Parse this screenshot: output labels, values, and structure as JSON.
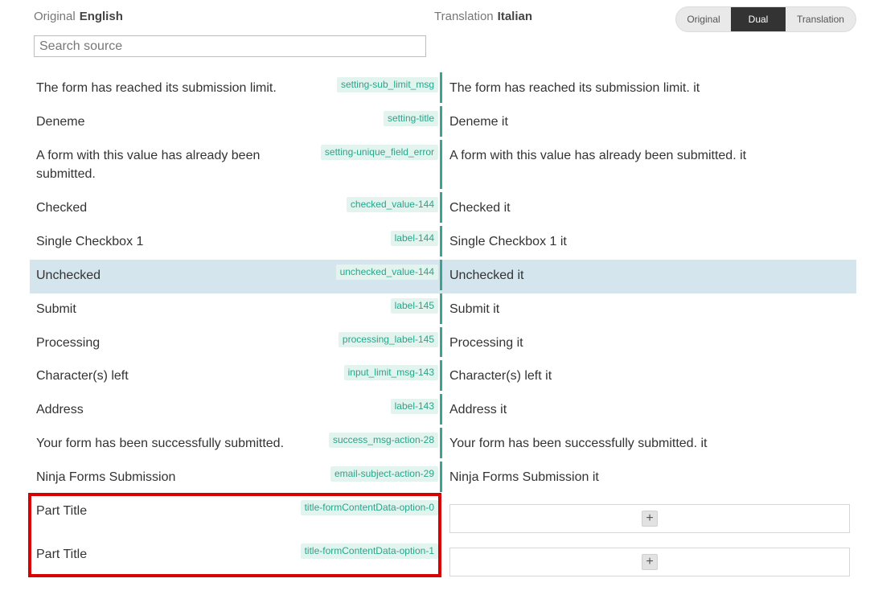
{
  "header": {
    "original_label": "Original",
    "original_lang": "English",
    "translation_label": "Translation",
    "translation_lang": "Italian"
  },
  "view_toggle": {
    "options": [
      "Original",
      "Dual",
      "Translation"
    ],
    "selected": "Dual"
  },
  "search": {
    "placeholder": "Search source",
    "value": ""
  },
  "rows": [
    {
      "source": "The form has reached its submission limit.",
      "key": "setting-sub_limit_msg",
      "translation": "The form has reached its submission limit. it"
    },
    {
      "source": "Deneme",
      "key": "setting-title",
      "translation": "Deneme it"
    },
    {
      "source": "A form with this value has already been submitted.",
      "key": "setting-unique_field_error",
      "translation": "A form with this value has already been submitted. it"
    },
    {
      "source": "Checked",
      "key": "checked_value-144",
      "translation": "Checked it"
    },
    {
      "source": "Single Checkbox 1",
      "key": "label-144",
      "translation": "Single Checkbox 1 it"
    },
    {
      "source": "Unchecked",
      "key": "unchecked_value-144",
      "translation": "Unchecked it",
      "selected": true
    },
    {
      "source": "Submit",
      "key": "label-145",
      "translation": "Submit it"
    },
    {
      "source": "Processing",
      "key": "processing_label-145",
      "translation": "Processing it"
    },
    {
      "source": "Character(s) left",
      "key": "input_limit_msg-143",
      "translation": "Character(s) left it"
    },
    {
      "source": "Address",
      "key": "label-143",
      "translation": "Address it"
    },
    {
      "source": "Your form has been successfully submitted.",
      "key": "success_msg-action-28",
      "translation": "Your form has been successfully submitted. it"
    },
    {
      "source": "Ninja Forms Submission",
      "key": "email-subject-action-29",
      "translation": "Ninja Forms Submission it"
    },
    {
      "source": "Part Title",
      "key": "title-formContentData-option-0",
      "translation": ""
    },
    {
      "source": "Part Title",
      "key": "title-formContentData-option-1",
      "translation": ""
    }
  ],
  "add_button_label": "+",
  "colors": {
    "accent": "#3aa493",
    "badge_bg": "#e3f4ef",
    "badge_text": "#26a58a",
    "selected_row": "#d5e5ee",
    "highlight_border": "#d60000"
  }
}
